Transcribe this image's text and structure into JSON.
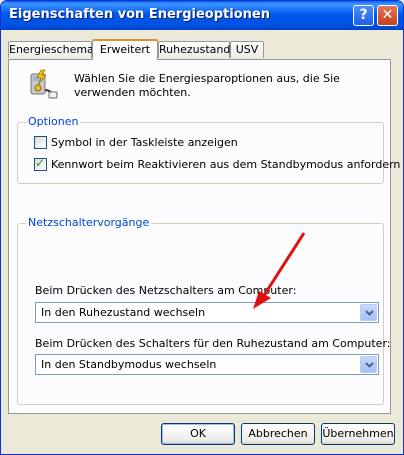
{
  "window": {
    "title": "Eigenschaften von Energieoptionen",
    "help_glyph": "?",
    "close_glyph": "✕"
  },
  "tabs": [
    {
      "label": "Energieschemas"
    },
    {
      "label": "Erweitert"
    },
    {
      "label": "Ruhezustand"
    },
    {
      "label": "USV"
    }
  ],
  "intro": {
    "text": "Wählen Sie die Energiesparoptionen aus, die Sie verwenden möchten."
  },
  "options": {
    "legend": "Optionen",
    "taskbar_icon": {
      "label": "Symbol in der Taskleiste anzeigen",
      "checked": false
    },
    "password_resume": {
      "label": "Kennwort beim Reaktivieren aus dem Standbymodus anfordern",
      "checked": true
    }
  },
  "power_buttons": {
    "legend": "Netzschaltervorgänge",
    "power_button_label": "Beim Drücken des Netzschalters am Computer:",
    "power_button_value": "In den Ruhezustand wechseln",
    "sleep_button_label": "Beim Drücken des Schalters für den Ruhezustand am Computer:",
    "sleep_button_value": "In den Standbymodus wechseln"
  },
  "buttons": {
    "ok": "OK",
    "cancel": "Abbrechen",
    "apply": "Übernehmen"
  },
  "colors": {
    "titlebar": "#0058ee",
    "group_legend": "#0046d5",
    "annotation_arrow": "#e01010"
  }
}
